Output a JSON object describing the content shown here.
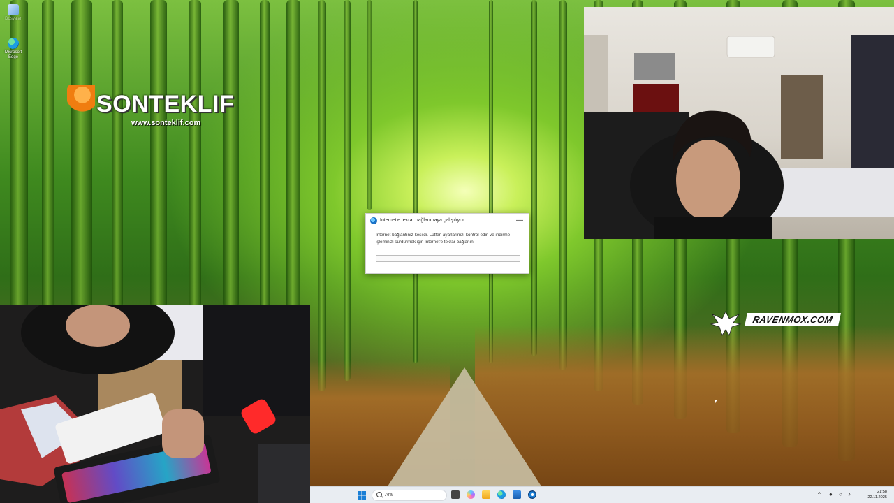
{
  "desktop": {
    "icons": [
      {
        "label": "Dosyalar"
      },
      {
        "label": "Microsoft Edge"
      }
    ]
  },
  "overlays": {
    "brand_left": {
      "name": "SONTEKLIF",
      "url": "www.sonteklif.com"
    },
    "brand_right": {
      "name": "RAVENMOX.COM"
    }
  },
  "dialog": {
    "title": "Internet'e tekrar bağlanmaya çalışılıyor...",
    "message": "Internet bağlantınız kesildi. Lütfen ayarlarınızı kontrol edin ve indirme işleminizi sürdürmek için Internet'e tekrar bağlanın.",
    "minimize_symbol": "—",
    "progress": 0
  },
  "taskbar": {
    "search_placeholder": "Ara",
    "pinned_apps": [
      "start",
      "search",
      "task-view",
      "copilot",
      "file-explorer",
      "edge",
      "store",
      "settings"
    ],
    "tray": {
      "chevron": "^",
      "time": "21:58",
      "date": "22.11.2025"
    }
  },
  "colors": {
    "taskbar_bg": "#e9edf2",
    "dialog_bg": "#ffffff",
    "windows_blue": "#0a64c8",
    "brand_orange": "#f07d10"
  }
}
